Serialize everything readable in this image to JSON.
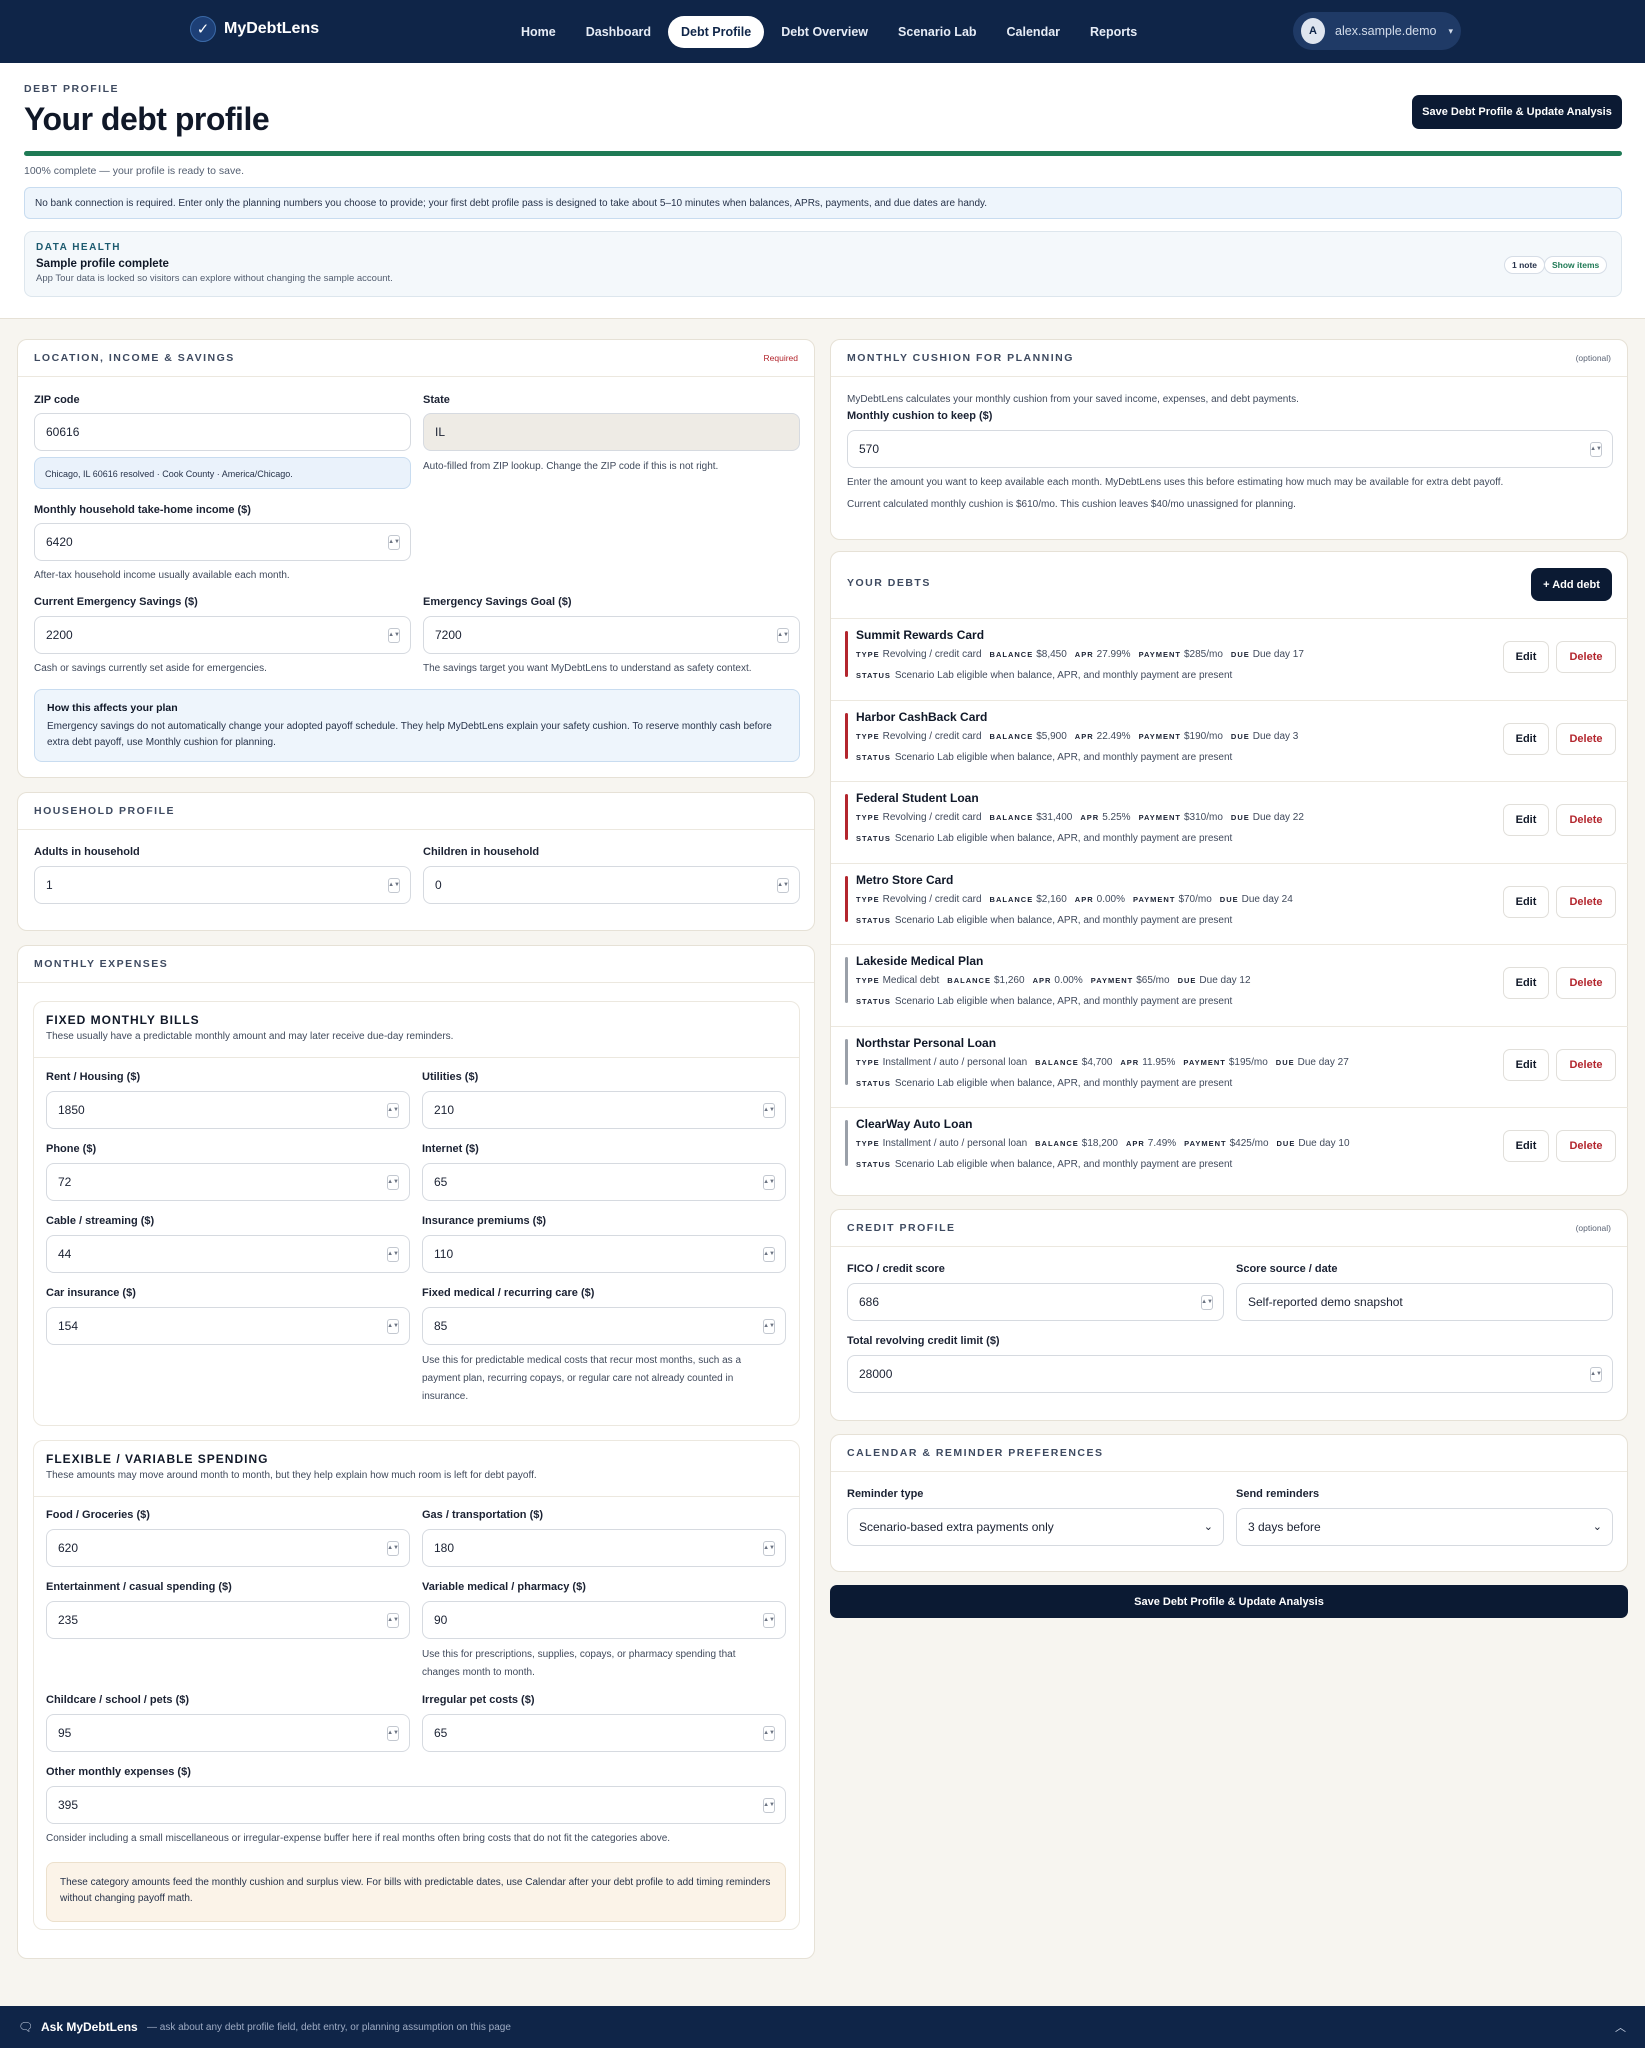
{
  "nav": {
    "brand": "MyDebtLens",
    "links": [
      "Home",
      "Dashboard",
      "Debt Profile",
      "Debt Overview",
      "Scenario Lab",
      "Calendar",
      "Reports"
    ],
    "active": "Debt Profile",
    "user_initial": "A",
    "user_name": "alex.sample.demo"
  },
  "header": {
    "kicker": "DEBT PROFILE",
    "title": "Your debt profile",
    "save_label": "Save Debt Profile & Update Analysis",
    "progress_pct": 100,
    "progress_text": "100% complete — your profile is ready to save.",
    "info": "No bank connection is required. Enter only the planning numbers you choose to provide; your first debt profile pass is designed to take about 5–10 minutes when balances, APRs, payments, and due dates are handy.",
    "health_kicker": "DATA HEALTH",
    "health_title": "Sample profile complete",
    "health_desc": "App Tour data is locked so visitors can explore without changing the sample account.",
    "note_pill": "1 note",
    "show_pill": "Show items"
  },
  "location": {
    "title": "LOCATION, INCOME & SAVINGS",
    "tag": "Required",
    "zip_label": "ZIP code",
    "zip_value": "60616",
    "zip_resolved": "Chicago, IL 60616 resolved · Cook County · America/Chicago.",
    "state_label": "State",
    "state_value": "IL",
    "state_help": "Auto-filled from ZIP lookup. Change the ZIP code if this is not right.",
    "income_label": "Monthly household take-home income ($)",
    "income_value": "6420",
    "income_help": "After-tax household income usually available each month.",
    "savings_label": "Current Emergency Savings ($)",
    "savings_value": "2200",
    "savings_help": "Cash or savings currently set aside for emergencies.",
    "goal_label": "Emergency Savings Goal ($)",
    "goal_value": "7200",
    "goal_help": "The savings target you want MyDebtLens to understand as safety context.",
    "plan_title": "How this affects your plan",
    "plan_text": "Emergency savings do not automatically change your adopted payoff schedule. They help MyDebtLens explain your safety cushion. To reserve monthly cash before extra debt payoff, use Monthly cushion for planning."
  },
  "household": {
    "title": "HOUSEHOLD PROFILE",
    "adults_label": "Adults in household",
    "adults_value": "1",
    "children_label": "Children in household",
    "children_value": "0"
  },
  "expenses": {
    "title": "MONTHLY EXPENSES",
    "fixed_title": "FIXED MONTHLY BILLS",
    "fixed_desc": "These usually have a predictable monthly amount and may later receive due-day reminders.",
    "rent_label": "Rent / Housing ($)",
    "rent_value": "1850",
    "utilities_label": "Utilities ($)",
    "utilities_value": "210",
    "phone_label": "Phone ($)",
    "phone_value": "72",
    "internet_label": "Internet ($)",
    "internet_value": "65",
    "cable_label": "Cable / streaming ($)",
    "cable_value": "44",
    "insurance_label": "Insurance premiums ($)",
    "insurance_value": "110",
    "car_label": "Car insurance ($)",
    "car_value": "154",
    "medical_label": "Fixed medical / recurring care ($)",
    "medical_value": "85",
    "medical_help": "Use this for predictable medical costs that recur most months, such as a payment plan, recurring copays, or regular care not already counted in insurance.",
    "flex_title": "FLEXIBLE / VARIABLE SPENDING",
    "flex_desc": "These amounts may move around month to month, but they help explain how much room is left for debt payoff.",
    "food_label": "Food / Groceries ($)",
    "food_value": "620",
    "gas_label": "Gas / transportation ($)",
    "gas_value": "180",
    "ent_label": "Entertainment / casual spending ($)",
    "ent_value": "235",
    "pharm_label": "Variable medical / pharmacy ($)",
    "pharm_value": "90",
    "pharm_help": "Use this for prescriptions, supplies, copays, or pharmacy spending that changes month to month.",
    "child_label": "Childcare / school / pets ($)",
    "child_value": "95",
    "pet_label": "Irregular pet costs ($)",
    "pet_value": "65",
    "other_label": "Other monthly expenses ($)",
    "other_value": "395",
    "other_help": "Consider including a small miscellaneous or irregular-expense buffer here if real months often bring costs that do not fit the categories above.",
    "footer_note": "These category amounts feed the monthly cushion and surplus view. For bills with predictable dates, use Calendar after your debt profile to add timing reminders without changing payoff math."
  },
  "cushion": {
    "title": "MONTHLY CUSHION FOR PLANNING",
    "tag": "(optional)",
    "intro": "MyDebtLens calculates your monthly cushion from your saved income, expenses, and debt payments.",
    "label": "Monthly cushion to keep ($)",
    "value": "570",
    "help1": "Enter the amount you want to keep available each month. MyDebtLens uses this before estimating how much may be available for extra debt payoff.",
    "help2": "Current calculated monthly cushion is $610/mo. This cushion leaves $40/mo unassigned for planning."
  },
  "debts": {
    "title": "YOUR DEBTS",
    "add_label": "+ Add debt",
    "edit_label": "Edit",
    "delete_label": "Delete",
    "k_type": "TYPE",
    "k_balance": "BALANCE",
    "k_apr": "APR",
    "k_payment": "PAYMENT",
    "k_due": "DUE",
    "k_status": "STATUS",
    "items": [
      {
        "name": "Summit Rewards Card",
        "type": "Revolving / credit card",
        "balance": "$8,450",
        "apr": "27.99%",
        "payment": "$285/mo",
        "due": "Due day 17",
        "status": "Scenario Lab eligible when balance, APR, and monthly payment are present",
        "color": "#b3262e"
      },
      {
        "name": "Harbor CashBack Card",
        "type": "Revolving / credit card",
        "balance": "$5,900",
        "apr": "22.49%",
        "payment": "$190/mo",
        "due": "Due day 3",
        "status": "Scenario Lab eligible when balance, APR, and monthly payment are present",
        "color": "#b3262e"
      },
      {
        "name": "Federal Student Loan",
        "type": "Revolving / credit card",
        "balance": "$31,400",
        "apr": "5.25%",
        "payment": "$310/mo",
        "due": "Due day 22",
        "status": "Scenario Lab eligible when balance, APR, and monthly payment are present",
        "color": "#b3262e"
      },
      {
        "name": "Metro Store Card",
        "type": "Revolving / credit card",
        "balance": "$2,160",
        "apr": "0.00%",
        "payment": "$70/mo",
        "due": "Due day 24",
        "status": "Scenario Lab eligible when balance, APR, and monthly payment are present",
        "color": "#b3262e"
      },
      {
        "name": "Lakeside Medical Plan",
        "type": "Medical debt",
        "balance": "$1,260",
        "apr": "0.00%",
        "payment": "$65/mo",
        "due": "Due day 12",
        "status": "Scenario Lab eligible when balance, APR, and monthly payment are present",
        "color": "#9aa0a9"
      },
      {
        "name": "Northstar Personal Loan",
        "type": "Installment / auto / personal loan",
        "balance": "$4,700",
        "apr": "11.95%",
        "payment": "$195/mo",
        "due": "Due day 27",
        "status": "Scenario Lab eligible when balance, APR, and monthly payment are present",
        "color": "#9aa0a9"
      },
      {
        "name": "ClearWay Auto Loan",
        "type": "Installment / auto / personal loan",
        "balance": "$18,200",
        "apr": "7.49%",
        "payment": "$425/mo",
        "due": "Due day 10",
        "status": "Scenario Lab eligible when balance, APR, and monthly payment are present",
        "color": "#9aa0a9"
      }
    ]
  },
  "credit": {
    "title": "CREDIT PROFILE",
    "tag": "(optional)",
    "fico_label": "FICO / credit score",
    "fico_value": "686",
    "source_label": "Score source / date",
    "source_value": "Self-reported demo snapshot",
    "limit_label": "Total revolving credit limit ($)",
    "limit_value": "28000"
  },
  "calendar": {
    "title": "CALENDAR & REMINDER PREFERENCES",
    "type_label": "Reminder type",
    "type_value": "Scenario-based extra payments only",
    "send_label": "Send reminders",
    "send_value": "3 days before"
  },
  "bottom_save": "Save Debt Profile & Update Analysis",
  "ask": {
    "title": "Ask MyDebtLens",
    "desc": "— ask about any debt profile field, debt entry, or planning assumption on this page"
  }
}
